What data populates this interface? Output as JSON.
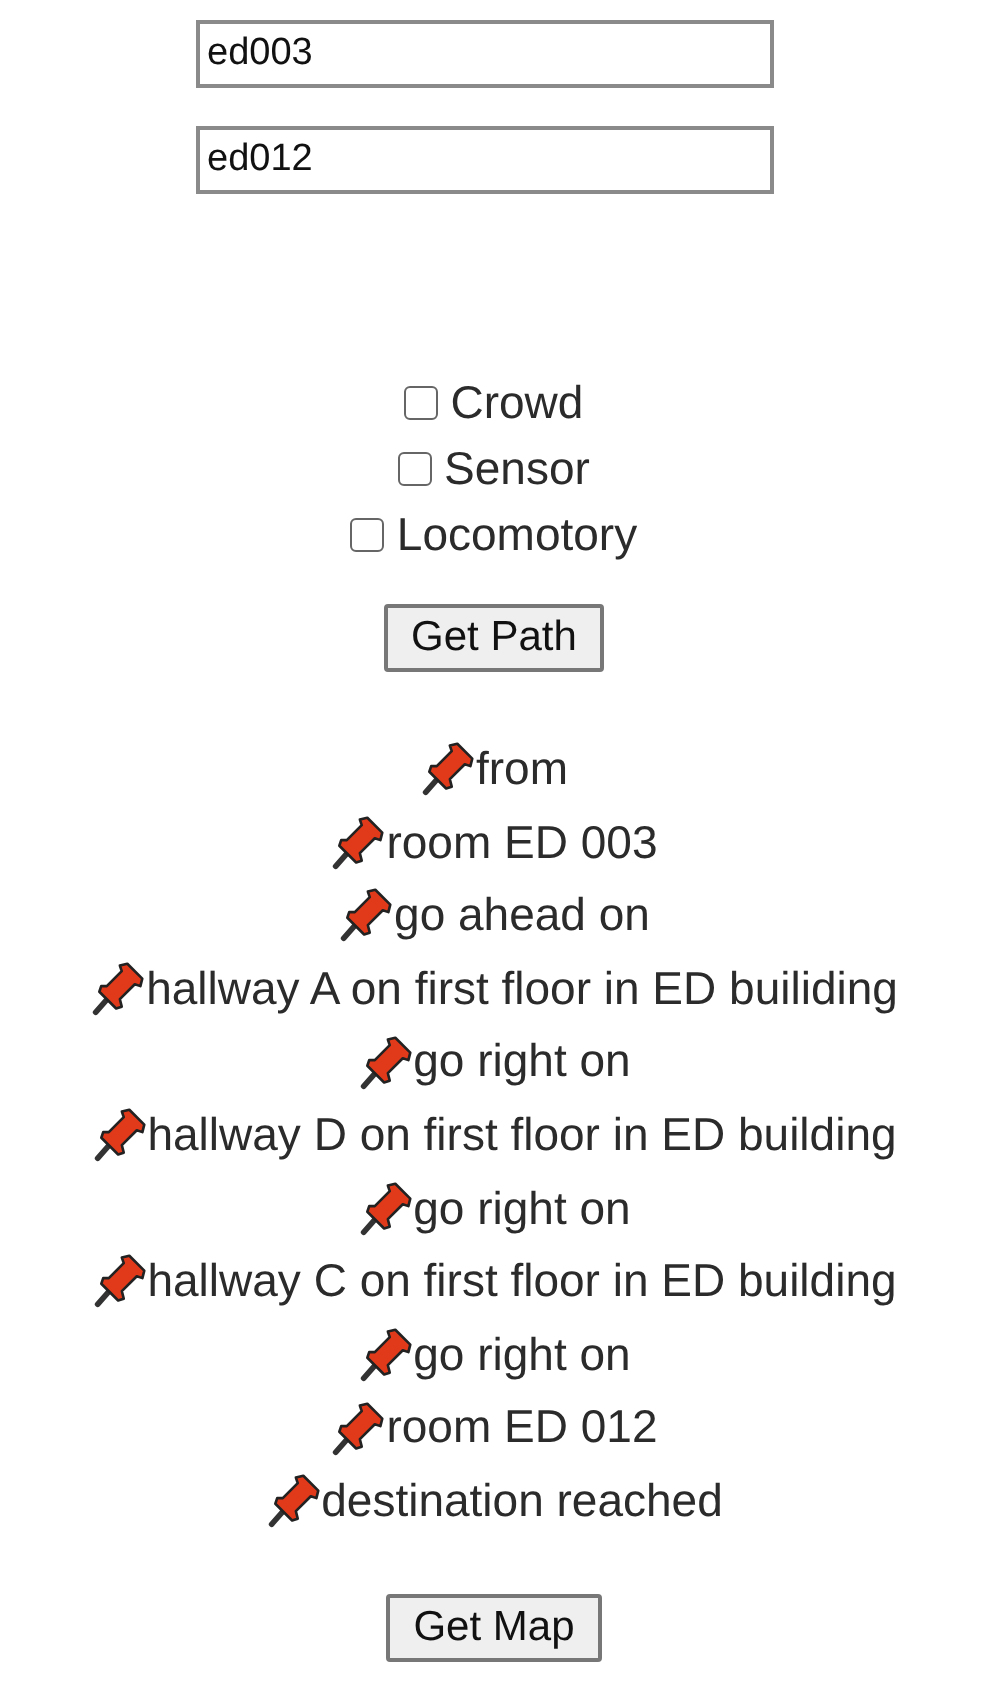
{
  "fields": [
    {
      "value": "ed003"
    },
    {
      "value": "ed012"
    }
  ],
  "options": [
    {
      "label": "Crowd",
      "checked": false
    },
    {
      "label": "Sensor",
      "checked": false
    },
    {
      "label": "Locomotory",
      "checked": false
    }
  ],
  "path_button": "Get Path",
  "steps": [
    "from",
    "room ED 003",
    "go ahead on",
    "hallway A on first floor in ED builiding",
    "go right on",
    "hallway D on first floor in ED building",
    "go right on",
    "hallway C on first floor in ED building",
    "go right on",
    "room ED 012",
    "destination reached"
  ],
  "map_button": "Get Map"
}
